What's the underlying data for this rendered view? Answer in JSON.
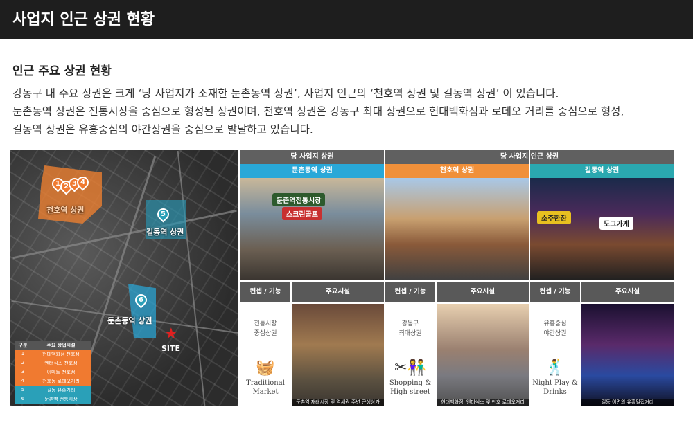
{
  "header": {
    "title": "사업지 인근 상권 현황"
  },
  "section": {
    "subtitle": "인근 주요 상권 현황",
    "desc": [
      "강동구 내 주요 상권은 크게 ‘당 사업지가 소재한 둔촌동역 상권’, 사업지 인근의 ‘천호역 상권 및 길동역 상권’ 이 있습니다.",
      "둔촌동역 상권은 전통시장을 중심으로 형성된 상권이며, 천호역 상권은 강동구 최대 상권으로 현대백화점과 로데오 거리를 중심으로 형성,",
      "길동역 상권은 유흥중심의 야간상권을 중심으로 발달하고 있습니다."
    ]
  },
  "map": {
    "zones": {
      "cheonho": "천호역 상권",
      "gildong": "길동역 상권",
      "dunchon": "둔촌동역 상권"
    },
    "pins": [
      "1",
      "2",
      "3",
      "4",
      "5",
      "6"
    ],
    "site_label": "SITE",
    "legend": {
      "header": [
        "구분",
        "주요 상업시설"
      ],
      "rows": [
        [
          "1",
          "현대백화점 천호점"
        ],
        [
          "2",
          "엔터식스 천호점"
        ],
        [
          "3",
          "이마트 천호점"
        ],
        [
          "4",
          "천호동 로데오거리"
        ],
        [
          "5",
          "길동 유흥거리"
        ],
        [
          "6",
          "둔촌역 전통시장"
        ]
      ]
    },
    "colors": {
      "orange": "#f07a30",
      "teal": "#2aa0b8"
    }
  },
  "table": {
    "group_headers": {
      "own": "당 사업지 상권",
      "nearby": "당 사업지 인근 상권"
    },
    "columns": [
      {
        "name": "둔촌동역 상권",
        "color": "#29a8d8",
        "photo_signs": [
          "둔촌역전통시장",
          "스크린골프"
        ],
        "concept_header": "컨셉 / 기능",
        "facility_header": "주요시설",
        "concept": [
          "전통시장",
          "중심상권"
        ],
        "icon_label": [
          "Traditional",
          "Market"
        ],
        "caption": "둔촌역 재래시장 및 역세권 주변 근생상가"
      },
      {
        "name": "천호역 상권",
        "color": "#f0903a",
        "photo_signs": [],
        "concept_header": "컨셉 / 기능",
        "facility_header": "주요시설",
        "concept": [
          "강동구",
          "최대상권"
        ],
        "icon_label": [
          "Shopping &",
          "High street"
        ],
        "caption": "현대백화점, 엔터식스 및 천호 로데오거리"
      },
      {
        "name": "길동역 상권",
        "color": "#2aa8b0",
        "photo_signs": [
          "소주한잔",
          "도그가게"
        ],
        "concept_header": "컨셉 / 기능",
        "facility_header": "주요시설",
        "concept": [
          "유흥중심",
          "야간상권"
        ],
        "icon_label": [
          "Night Play &",
          "Drinks"
        ],
        "caption": "길동 이면의 유흥밀집거리"
      }
    ]
  }
}
